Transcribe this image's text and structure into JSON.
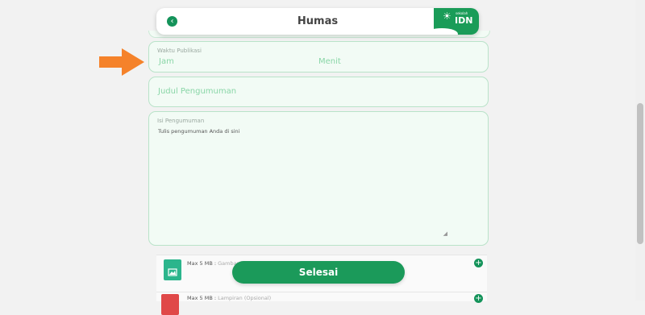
{
  "header": {
    "title": "Humas",
    "back_icon": "chevron-left-icon",
    "logo_small": "sekolah",
    "logo_text": "IDN"
  },
  "waktu": {
    "label": "Waktu Publikasi",
    "jam_placeholder": "Jam",
    "menit_placeholder": "Menit"
  },
  "judul": {
    "placeholder": "Judul Pengumuman"
  },
  "isi": {
    "label": "Isi Pengumuman",
    "placeholder": "Tulis pengumuman Anda di sini"
  },
  "uploads": [
    {
      "size": "Max 5 MB",
      "type": "Gambar Pengumuman",
      "icon": "image-file-icon",
      "color": "#2bb58c"
    },
    {
      "size": "Max 5 MB",
      "type": "Lampiran (Opsional)",
      "icon": "pdf-file-icon",
      "color": "#e04848"
    }
  ],
  "actions": {
    "submit": "Selesai"
  },
  "colors": {
    "primary": "#1b9a5a",
    "card_bg": "#f2fbf5",
    "card_border": "#b9e3c9",
    "arrow": "#f5822a"
  }
}
